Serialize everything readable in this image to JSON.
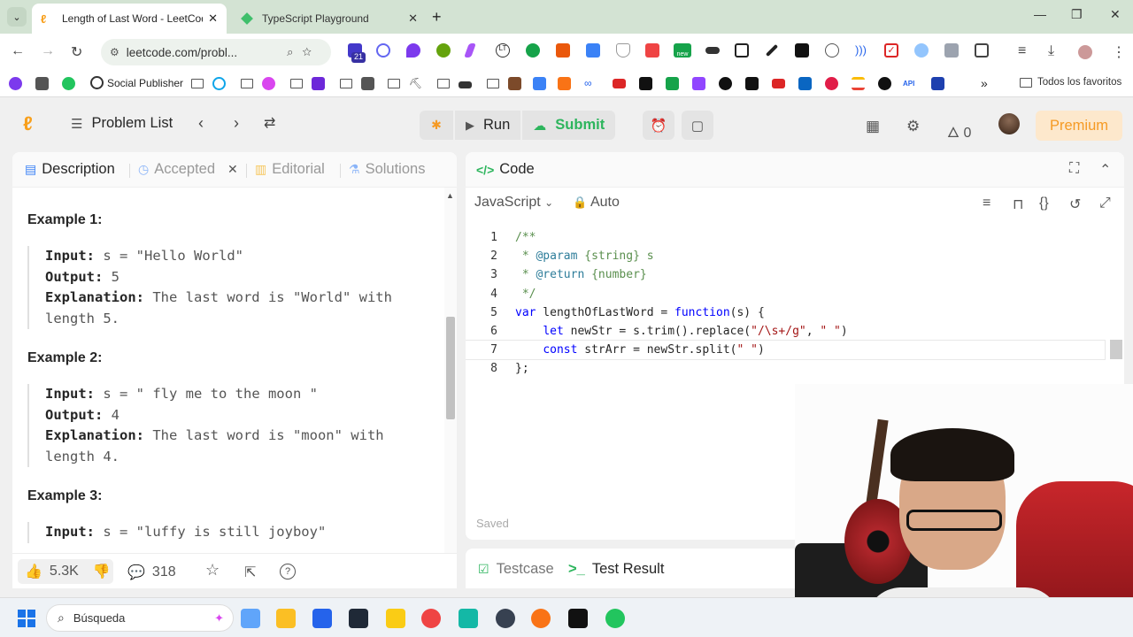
{
  "browser": {
    "tabs": [
      {
        "title": "Length of Last Word - LeetCode",
        "active": true
      },
      {
        "title": "TypeScript Playground",
        "active": false
      }
    ],
    "address": "leetcode.com/probl...",
    "bookmarks": {
      "social_publisher": "Social Publisher",
      "all_favorites": "Todos los favoritos",
      "api_label": "API"
    },
    "extension_badge": "21",
    "extension_new": "new"
  },
  "app": {
    "nav": {
      "problem_list": "Problem List",
      "run": "Run",
      "submit": "Submit",
      "streak_count": "0",
      "premium": "Premium"
    },
    "left_tabs": {
      "description": "Description",
      "accepted": "Accepted",
      "editorial": "Editorial",
      "solutions": "Solutions"
    },
    "examples": [
      {
        "title": "Example 1:",
        "input_label": "Input:",
        "input": "s = \"Hello World\"",
        "output_label": "Output:",
        "output": "5",
        "explanation_label": "Explanation:",
        "explanation_1": "The last word is \"World\" with",
        "explanation_2": "length 5."
      },
      {
        "title": "Example 2:",
        "input_label": "Input:",
        "input": "s = \"   fly me   to   the moon  \"",
        "output_label": "Output:",
        "output": "4",
        "explanation_label": "Explanation:",
        "explanation_1": "The last word is \"moon\" with",
        "explanation_2": "length 4."
      },
      {
        "title": "Example 3:",
        "input_label": "Input:",
        "input": "s = \"luffy is still joyboy\""
      }
    ],
    "footer": {
      "likes": "5.3K",
      "comments": "318"
    },
    "code_panel": {
      "title": "Code",
      "language": "JavaScript",
      "mode": "Auto",
      "saved_status": "Saved",
      "lines": [
        {
          "n": "1"
        },
        {
          "n": "2"
        },
        {
          "n": "3"
        },
        {
          "n": "4"
        },
        {
          "n": "5"
        },
        {
          "n": "6"
        },
        {
          "n": "7"
        },
        {
          "n": "8"
        }
      ]
    },
    "bottom_tabs": {
      "testcase": "Testcase",
      "test_result": "Test Result"
    }
  },
  "taskbar": {
    "search_placeholder": "Búsqueda"
  },
  "colors": {
    "accent_green": "#2db55d",
    "brand_orange": "#f89f1b",
    "premium_bg": "#fde8cc"
  }
}
